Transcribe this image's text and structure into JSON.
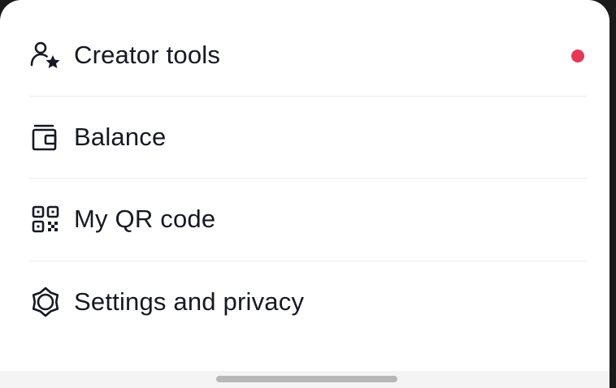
{
  "menu": {
    "items": [
      {
        "label": "Creator tools",
        "icon": "creator-tools-icon",
        "has_notification": true
      },
      {
        "label": "Balance",
        "icon": "wallet-icon",
        "has_notification": false
      },
      {
        "label": "My QR code",
        "icon": "qr-code-icon",
        "has_notification": false
      },
      {
        "label": "Settings and privacy",
        "icon": "gear-icon",
        "has_notification": false
      }
    ]
  },
  "colors": {
    "text": "#161823",
    "notification_dot": "#e43956",
    "divider": "#ececec",
    "sheet_background": "#ffffff",
    "home_indicator": "#b7b7b7"
  }
}
